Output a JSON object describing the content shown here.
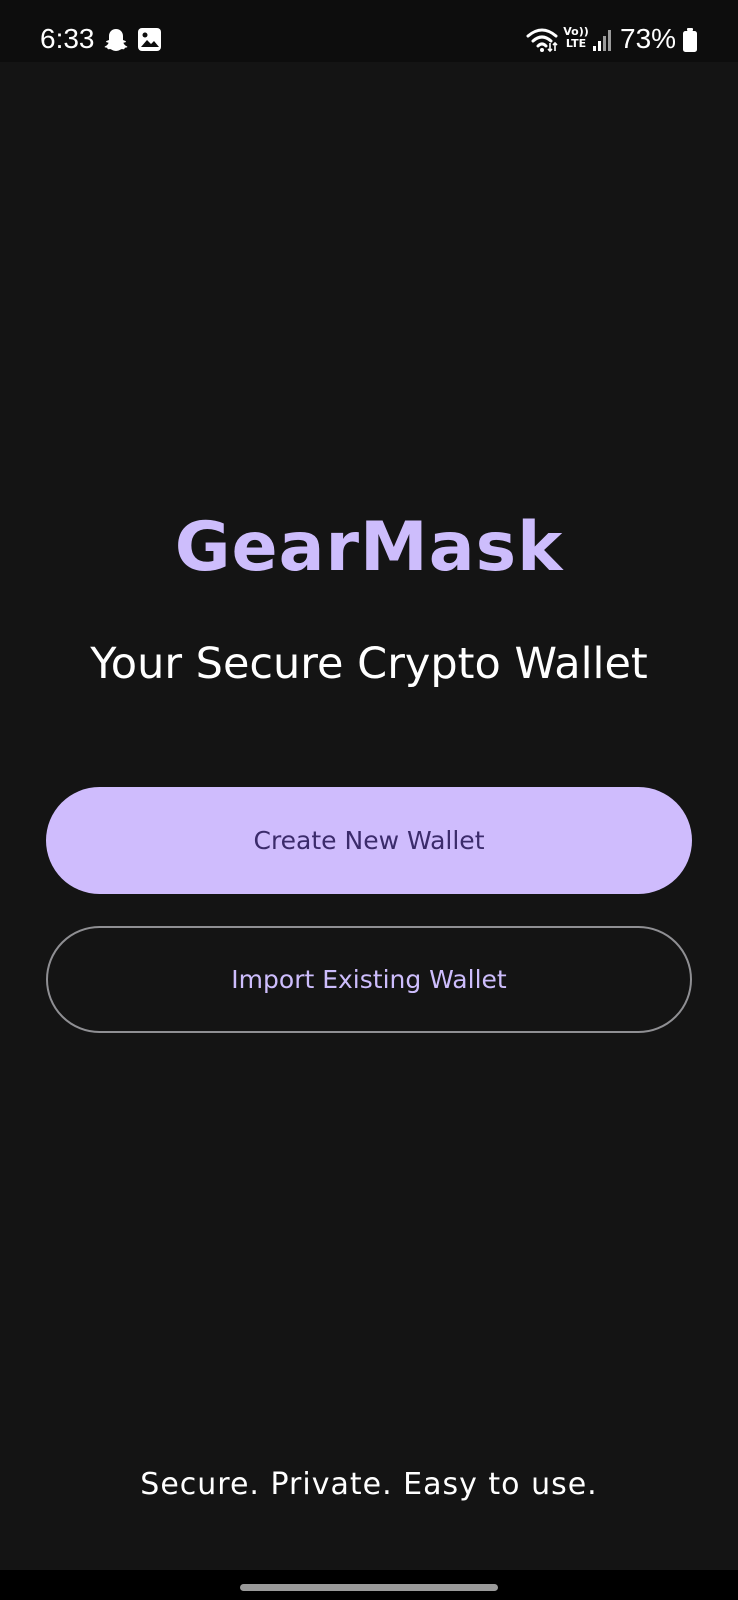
{
  "status_bar": {
    "time": "6:33",
    "battery_percent": "73%",
    "left_icons": [
      "snapchat-icon",
      "gallery-icon"
    ],
    "right_icons": [
      "wifi-icon",
      "volte-icon",
      "signal-icon",
      "battery-icon"
    ],
    "volte_label_top": "Vo))",
    "volte_label_bottom": "LTE"
  },
  "app": {
    "title": "GearMask",
    "subtitle": "Your Secure Crypto Wallet",
    "create_button_label": "Create New Wallet",
    "import_button_label": "Import Existing Wallet",
    "tagline": "Secure. Private. Easy to use."
  },
  "colors": {
    "background": "#141414",
    "accent": "#cdbdfc",
    "primary_button_bg": "#cfbcfd",
    "primary_button_text": "#3b2b6b",
    "outline": "#8f8f93"
  }
}
